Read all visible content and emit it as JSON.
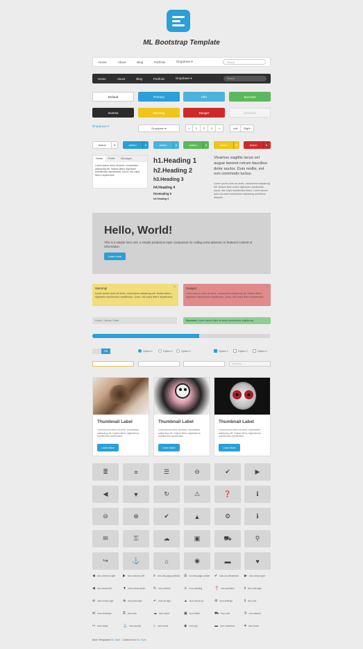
{
  "title": "ML Bootstrap Template",
  "navbar": {
    "items": [
      "Home",
      "About",
      "Blog",
      "Portfolio",
      "Dropdown ▾"
    ],
    "search_placeholder": "Search"
  },
  "buttons": {
    "row1": [
      "Default",
      "Primary",
      "Info",
      "Success"
    ],
    "row2": [
      "Inverse",
      "Warning",
      "Danger",
      "Disabled"
    ]
  },
  "dropdown_link": "Dropdown ▾",
  "dropdown_button": "Dropdown ▾",
  "pager": [
    "«",
    "1",
    "2",
    "3",
    "»"
  ],
  "lr": [
    "Left",
    "Right"
  ],
  "split_label": "Action",
  "tabs": {
    "labels": [
      "Home",
      "Profile",
      "Messages"
    ],
    "text": "Lorem ipsum dolor sit amet, consectetur adipiscing elit. Nullam libero dignissim repellendus repellendus. Quod, nisi culpa libero repellendus"
  },
  "headings": [
    "h1.Heading 1",
    "h2.Heading 2",
    "h3.Heading 3",
    "h4.Heading 4",
    "h5.Heading 5",
    "h6.Heading 6"
  ],
  "lead": "Vivamus sagittis lacus vel augue laoreet rutrum faucibus dolor auctor. Duis mollis, est non commodo luctus.",
  "lead_small": "Lorem ipsum dolor sit amet, consectetur adipiscing elit. Nullam libero dolor dignissim repellendus. Quod, nisi culpa repellendus libero. Lorem ipsum dolor sit amet consectetur adipiscing architecto aliquam.",
  "jumbotron": {
    "heading": "Hello, World!",
    "text": "This is a simple hero unit, a simple jumbotron-style component for calling extra attention to featured content or information.",
    "button": "Learn more"
  },
  "alerts": {
    "warning_title": "Warning!",
    "warning_text": "Lorem ipsum dolor sit amet, consectetur adipiscing elit. Nullam libero dignissim repellendus repellendus. Quod, nisi culpa libero repellendus",
    "danger_title": "Danger!",
    "danger_text": "Lorem ipsum dolor sit amet, consectetur adipiscing elit. Nullam libero dignissim repellendus repellendus. Quod, nisi culpa libero repellendus",
    "close": "×"
  },
  "breadcrumb": "Home  /  Library  /  Data",
  "success": {
    "title": "Success!",
    "text": " Lorem ipsum dolor sit amet consectetur adipiscing"
  },
  "progress": 0.6,
  "toggle": [
    "",
    "ON"
  ],
  "radios": [
    "Option 1",
    "Option 2",
    "Option 3"
  ],
  "checks": [
    "Option 1",
    "Option 2",
    "Option 3"
  ],
  "inputs": [
    "",
    "",
    "Disabled"
  ],
  "thumbnails": [
    {
      "label": "Thumbnail Label",
      "text": "Lorem ipsum dolor sit amet, consectetur adipiscing elit. Nullam libero dignissimos repellendus repellendus.",
      "button": "Learn More"
    },
    {
      "label": "Thumbnail Label",
      "text": "Lorem ipsum dolor sit amet, consectetur adipiscing elit. Nullam libero dignissimos repellendus repellendus.",
      "button": "Learn More"
    },
    {
      "label": "Thumbnail Label",
      "text": "Lorem ipsum dolor sit amet, consectetur adipiscing elit. Nullam libero dignissimos repellendus repellendus.",
      "button": "Learn More"
    }
  ],
  "icon_grid": [
    [
      "≣",
      "≡",
      "☰",
      "⊖",
      "✔",
      "▶"
    ],
    [
      "◀",
      "▼",
      "↻",
      "⚠",
      "❓",
      "ℹ"
    ],
    [
      "⊖",
      "⊕",
      "✔",
      "▲",
      "⚙",
      "ℹ"
    ],
    [
      "✉",
      "⚿",
      "☁",
      "▣",
      "⛟",
      "⚲"
    ],
    [
      "↪",
      "⚓",
      "⌂",
      "◉",
      "▬",
      "♥"
    ]
  ],
  "icon_list": [
    [
      [
        "◀",
        "icon-chevron-right"
      ],
      [
        "▶",
        "icon-chevron-left"
      ],
      [
        "≡",
        "icon-list-page-portfolio"
      ],
      [
        "☰",
        "icon-list-page-center"
      ],
      [
        "✔",
        "icon-ok-checkmark"
      ],
      [
        "▶",
        "icon-arrow-right"
      ]
    ],
    [
      [
        "◀",
        "icon-arrow-left"
      ],
      [
        "▼",
        "icon-arrow-down"
      ],
      [
        "↻",
        "icon-refresh"
      ],
      [
        "⚠",
        "icon-warning"
      ],
      [
        "❓",
        "icon-question"
      ],
      [
        "ℹ",
        "icon-info-sign"
      ]
    ],
    [
      [
        "⊖",
        "icon-minus-sign"
      ],
      [
        "⊕",
        "icon-plus-sign"
      ],
      [
        "✔",
        "icon-ok-sign"
      ],
      [
        "▲",
        "icon-arrow-up"
      ],
      [
        "⚙",
        "icon-settings"
      ],
      [
        "ℹ",
        "icon-info"
      ]
    ],
    [
      [
        "✉",
        "icon-envelope"
      ],
      [
        "⚿",
        "icon-lock"
      ],
      [
        "☁",
        "icon-cloud"
      ],
      [
        "▣",
        "icon-folder"
      ],
      [
        "⛟",
        "icon-cart"
      ],
      [
        "⚲",
        "icon-search"
      ]
    ],
    [
      [
        "↪",
        "icon-share"
      ],
      [
        "⚓",
        "icon-anchor"
      ],
      [
        "⌂",
        "icon-home"
      ],
      [
        "◉",
        "icon-eye"
      ],
      [
        "▬",
        "icon-comment"
      ],
      [
        "♥",
        "icon-heart"
      ]
    ]
  ],
  "footer": {
    "prefix": "More Templates ",
    "link1": "ML Style",
    "mid": " - Collect from ",
    "link2": "ML Style"
  }
}
